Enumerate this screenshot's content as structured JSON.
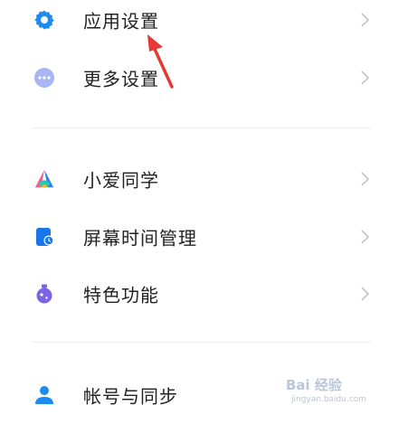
{
  "settings": {
    "items": [
      {
        "label": "应用设置",
        "icon": "gear-icon",
        "icon_color": "#1c8cf0"
      },
      {
        "label": "更多设置",
        "icon": "more-dots-icon",
        "icon_color": "#8ea3f1"
      },
      {
        "label": "小爱同学",
        "icon": "xiaoai-icon",
        "icon_color": "#3a7cf5"
      },
      {
        "label": "屏幕时间管理",
        "icon": "screen-time-icon",
        "icon_color": "#1877e8"
      },
      {
        "label": "特色功能",
        "icon": "flask-icon",
        "icon_color": "#7b63e6"
      },
      {
        "label": "帐号与同步",
        "icon": "user-icon",
        "icon_color": "#1c8cf0"
      }
    ]
  },
  "annotation": {
    "arrow_color": "#e53935"
  },
  "watermark": {
    "line1": "Bai 经验",
    "line2": "jingyan.baidu.com"
  }
}
